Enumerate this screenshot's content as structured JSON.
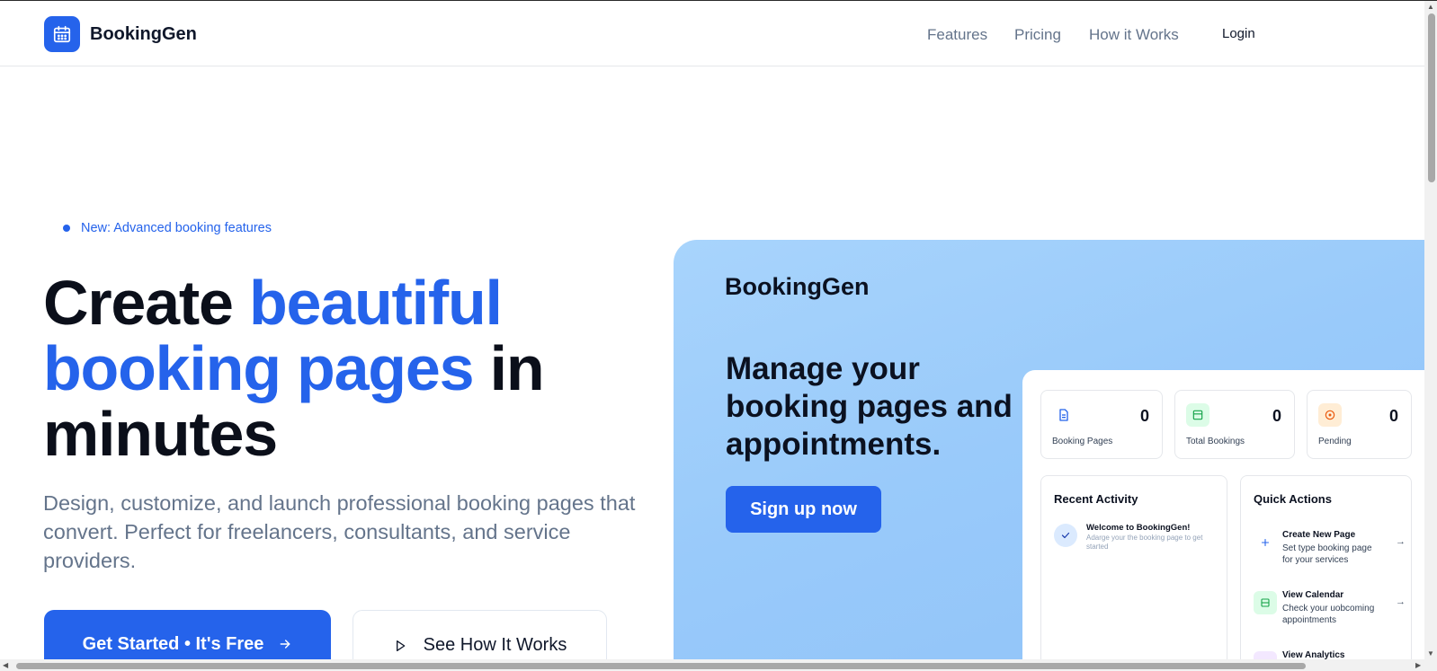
{
  "header": {
    "brand": "BookingGen",
    "nav": [
      "Features",
      "Pricing",
      "How it Works"
    ],
    "login": "Login"
  },
  "hero": {
    "badge": "New: Advanced booking features",
    "headline": {
      "part1": "Create ",
      "part2_blue": "beautiful",
      "part3_blue": "booking pages",
      "part4": " in",
      "part5": "minutes"
    },
    "subtitle": "Design, customize, and launch professional booking pages that convert. Perfect for freelancers, consultants, and service providers.",
    "cta_primary": "Get Started • It's Free",
    "cta_secondary": "See How It Works"
  },
  "preview": {
    "brand": "BookingGen",
    "heading": "Manage your booking pages and appointments.",
    "signup": "Sign up now",
    "stats": [
      {
        "label": "Booking Pages",
        "value": "0",
        "icon": "document-icon",
        "color": "#2563eb"
      },
      {
        "label": "Total Bookings",
        "value": "0",
        "icon": "calendar-icon",
        "color": "#16a34a"
      },
      {
        "label": "Pending",
        "value": "0",
        "icon": "clock-icon",
        "color": "#ea580c"
      }
    ],
    "recent_activity": {
      "title": "Recent Activity",
      "items": [
        {
          "title": "Welcome to BookingGen!",
          "desc": "Adarge your the booking page to get started"
        }
      ]
    },
    "quick_actions": {
      "title": "Quick Actions",
      "items": [
        {
          "title": "Create New Page",
          "desc": "Set type booking page for your services",
          "icon": "plus-icon"
        },
        {
          "title": "View Calendar",
          "desc": "Check your uobcoming appointments",
          "icon": "calendar-icon"
        },
        {
          "title": "View Analytics",
          "desc": "",
          "icon": "chart-icon"
        }
      ]
    }
  },
  "colors": {
    "accent": "#2563eb",
    "panel": "#9fcdfb",
    "muted_text": "#64748b"
  }
}
